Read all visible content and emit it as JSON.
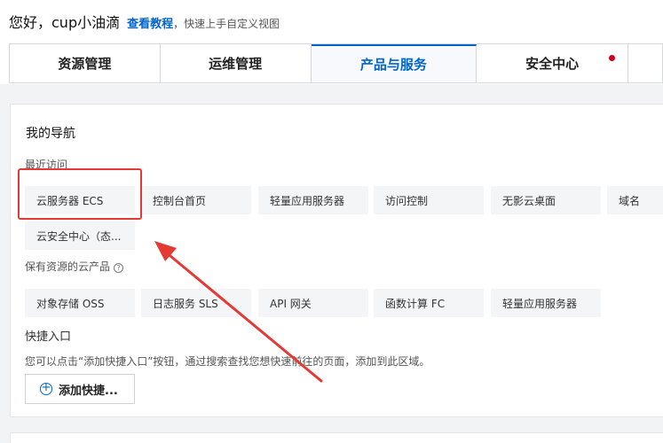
{
  "header": {
    "greeting": "您好，cup小油滴",
    "tutorial_link": "查看教程",
    "tip": "，快速上手自定义视图"
  },
  "tabs": [
    {
      "label": "资源管理"
    },
    {
      "label": "运维管理"
    },
    {
      "label": "产品与服务",
      "active": true
    },
    {
      "label": "安全中心",
      "has_notification": true
    }
  ],
  "nav": {
    "title": "我的导航",
    "recent_label": "最近访问",
    "recent": [
      "云服务器 ECS",
      "控制台首页",
      "轻量应用服务器",
      "访问控制",
      "无影云桌面",
      "域名",
      "云安全中心（态..."
    ],
    "owned_label": "保有资源的云产品",
    "owned": [
      "对象存储 OSS",
      "日志服务 SLS",
      "API 网关",
      "函数计算 FC",
      "轻量应用服务器"
    ],
    "quick_label": "快捷入口",
    "quick_hint": "您可以点击“添加快捷入口”按钮，通过搜索查找您想快速前往的页面，添加到此区域。",
    "add_button": "添加快捷..."
  },
  "colors": {
    "accent": "#0064c8",
    "annotation": "#e53935",
    "notification": "#d0021b"
  },
  "icons": {
    "help": "question-circle-icon",
    "add": "plus-circle-icon"
  }
}
